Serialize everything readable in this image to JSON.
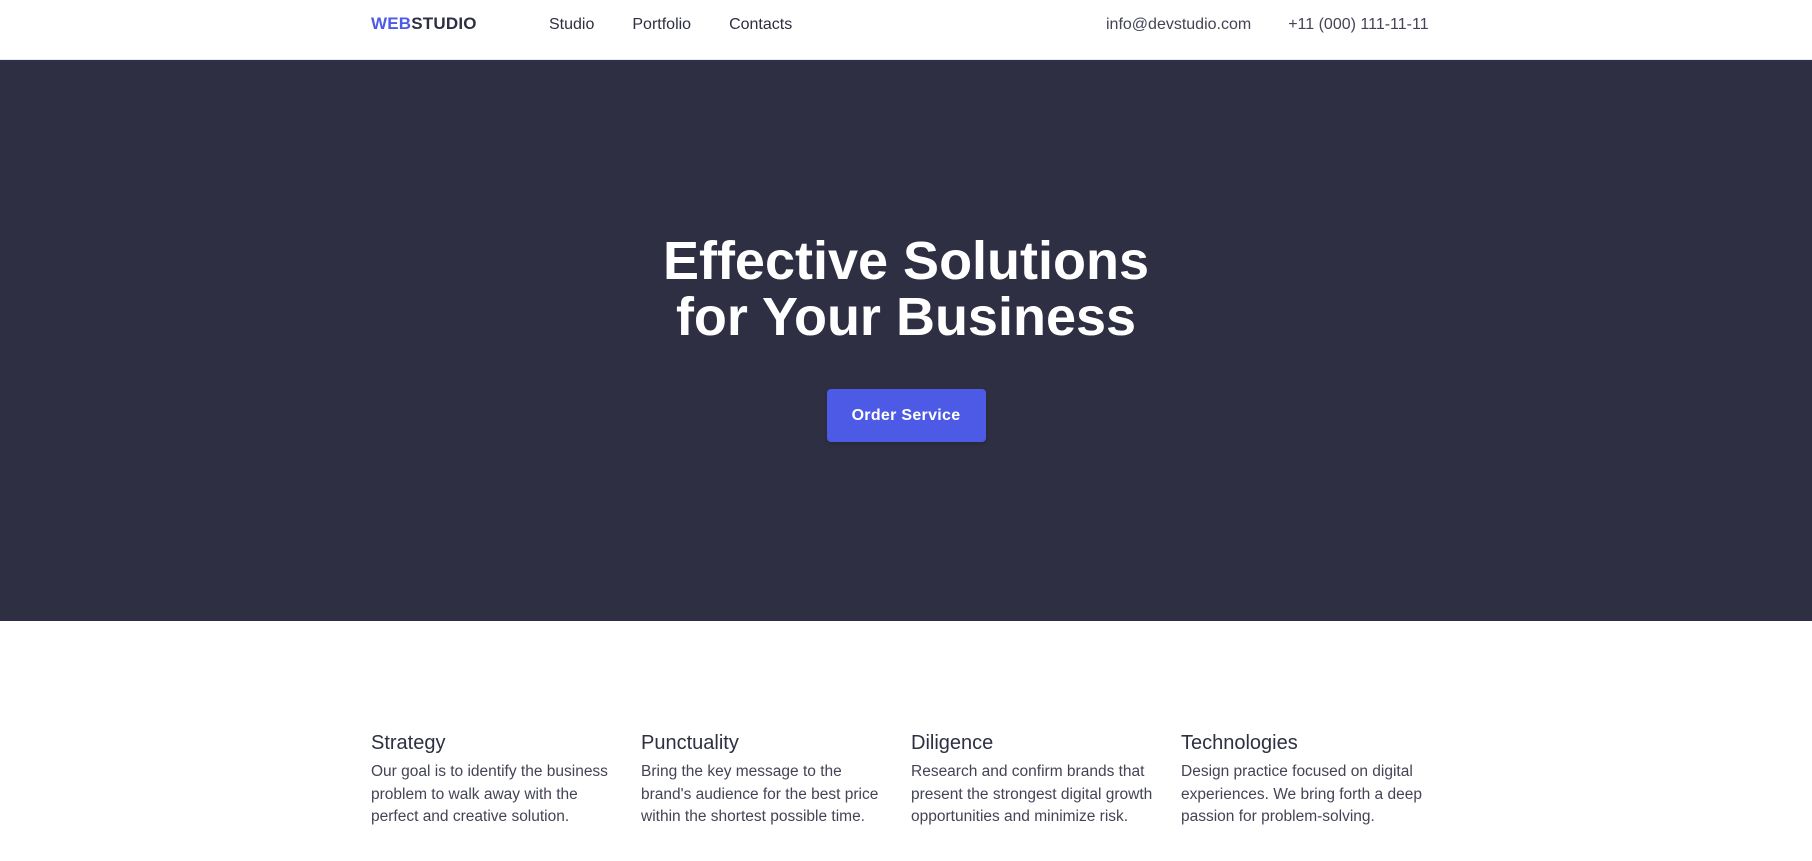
{
  "header": {
    "logo_accent": "WEB",
    "logo_main": "STUDIO",
    "nav": [
      "Studio",
      "Portfolio",
      "Contacts"
    ],
    "email": "info@devstudio.com",
    "phone": "+11 (000) 111-11-11"
  },
  "hero": {
    "title_line1": "Effective Solutions",
    "title_line2": "for Your Business",
    "cta_label": "Order Service"
  },
  "features": [
    {
      "title": "Strategy",
      "text": "Our goal is to identify the business problem to walk away with the perfect and creative solution."
    },
    {
      "title": "Punctuality",
      "text": "Bring the key message to the brand's audience for the best price within the shortest possible time."
    },
    {
      "title": "Diligence",
      "text": "Research and confirm brands that present the strongest digital growth opportunities and minimize risk."
    },
    {
      "title": "Technologies",
      "text": "Design practice focused on digital experiences. We bring forth a deep passion for problem-solving."
    }
  ],
  "colors": {
    "accent": "#4d5ae5",
    "hero_bg": "#2e2f42",
    "text_dark": "#2e2f42",
    "text_body": "#434455"
  }
}
